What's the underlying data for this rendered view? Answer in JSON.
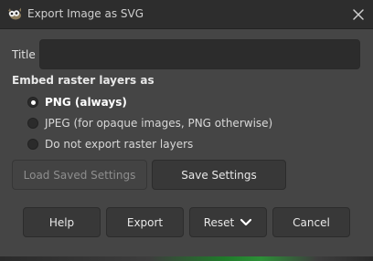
{
  "window": {
    "title": "Export Image as SVG"
  },
  "form": {
    "title_label": "Title",
    "title_value": "",
    "embed_heading": "Embed raster layers as",
    "options": [
      {
        "label": "PNG (always)",
        "selected": true
      },
      {
        "label": "JPEG (for opaque images, PNG otherwise)",
        "selected": false
      },
      {
        "label": "Do not export raster layers",
        "selected": false
      }
    ]
  },
  "settings_buttons": {
    "load": "Load Saved Settings",
    "save": "Save Settings"
  },
  "actions": {
    "help": "Help",
    "export": "Export",
    "reset": "Reset",
    "cancel": "Cancel"
  },
  "icons": {
    "app": "gimp-wilber-icon",
    "close": "close-icon",
    "reset_menu": "chevron-down-icon"
  }
}
